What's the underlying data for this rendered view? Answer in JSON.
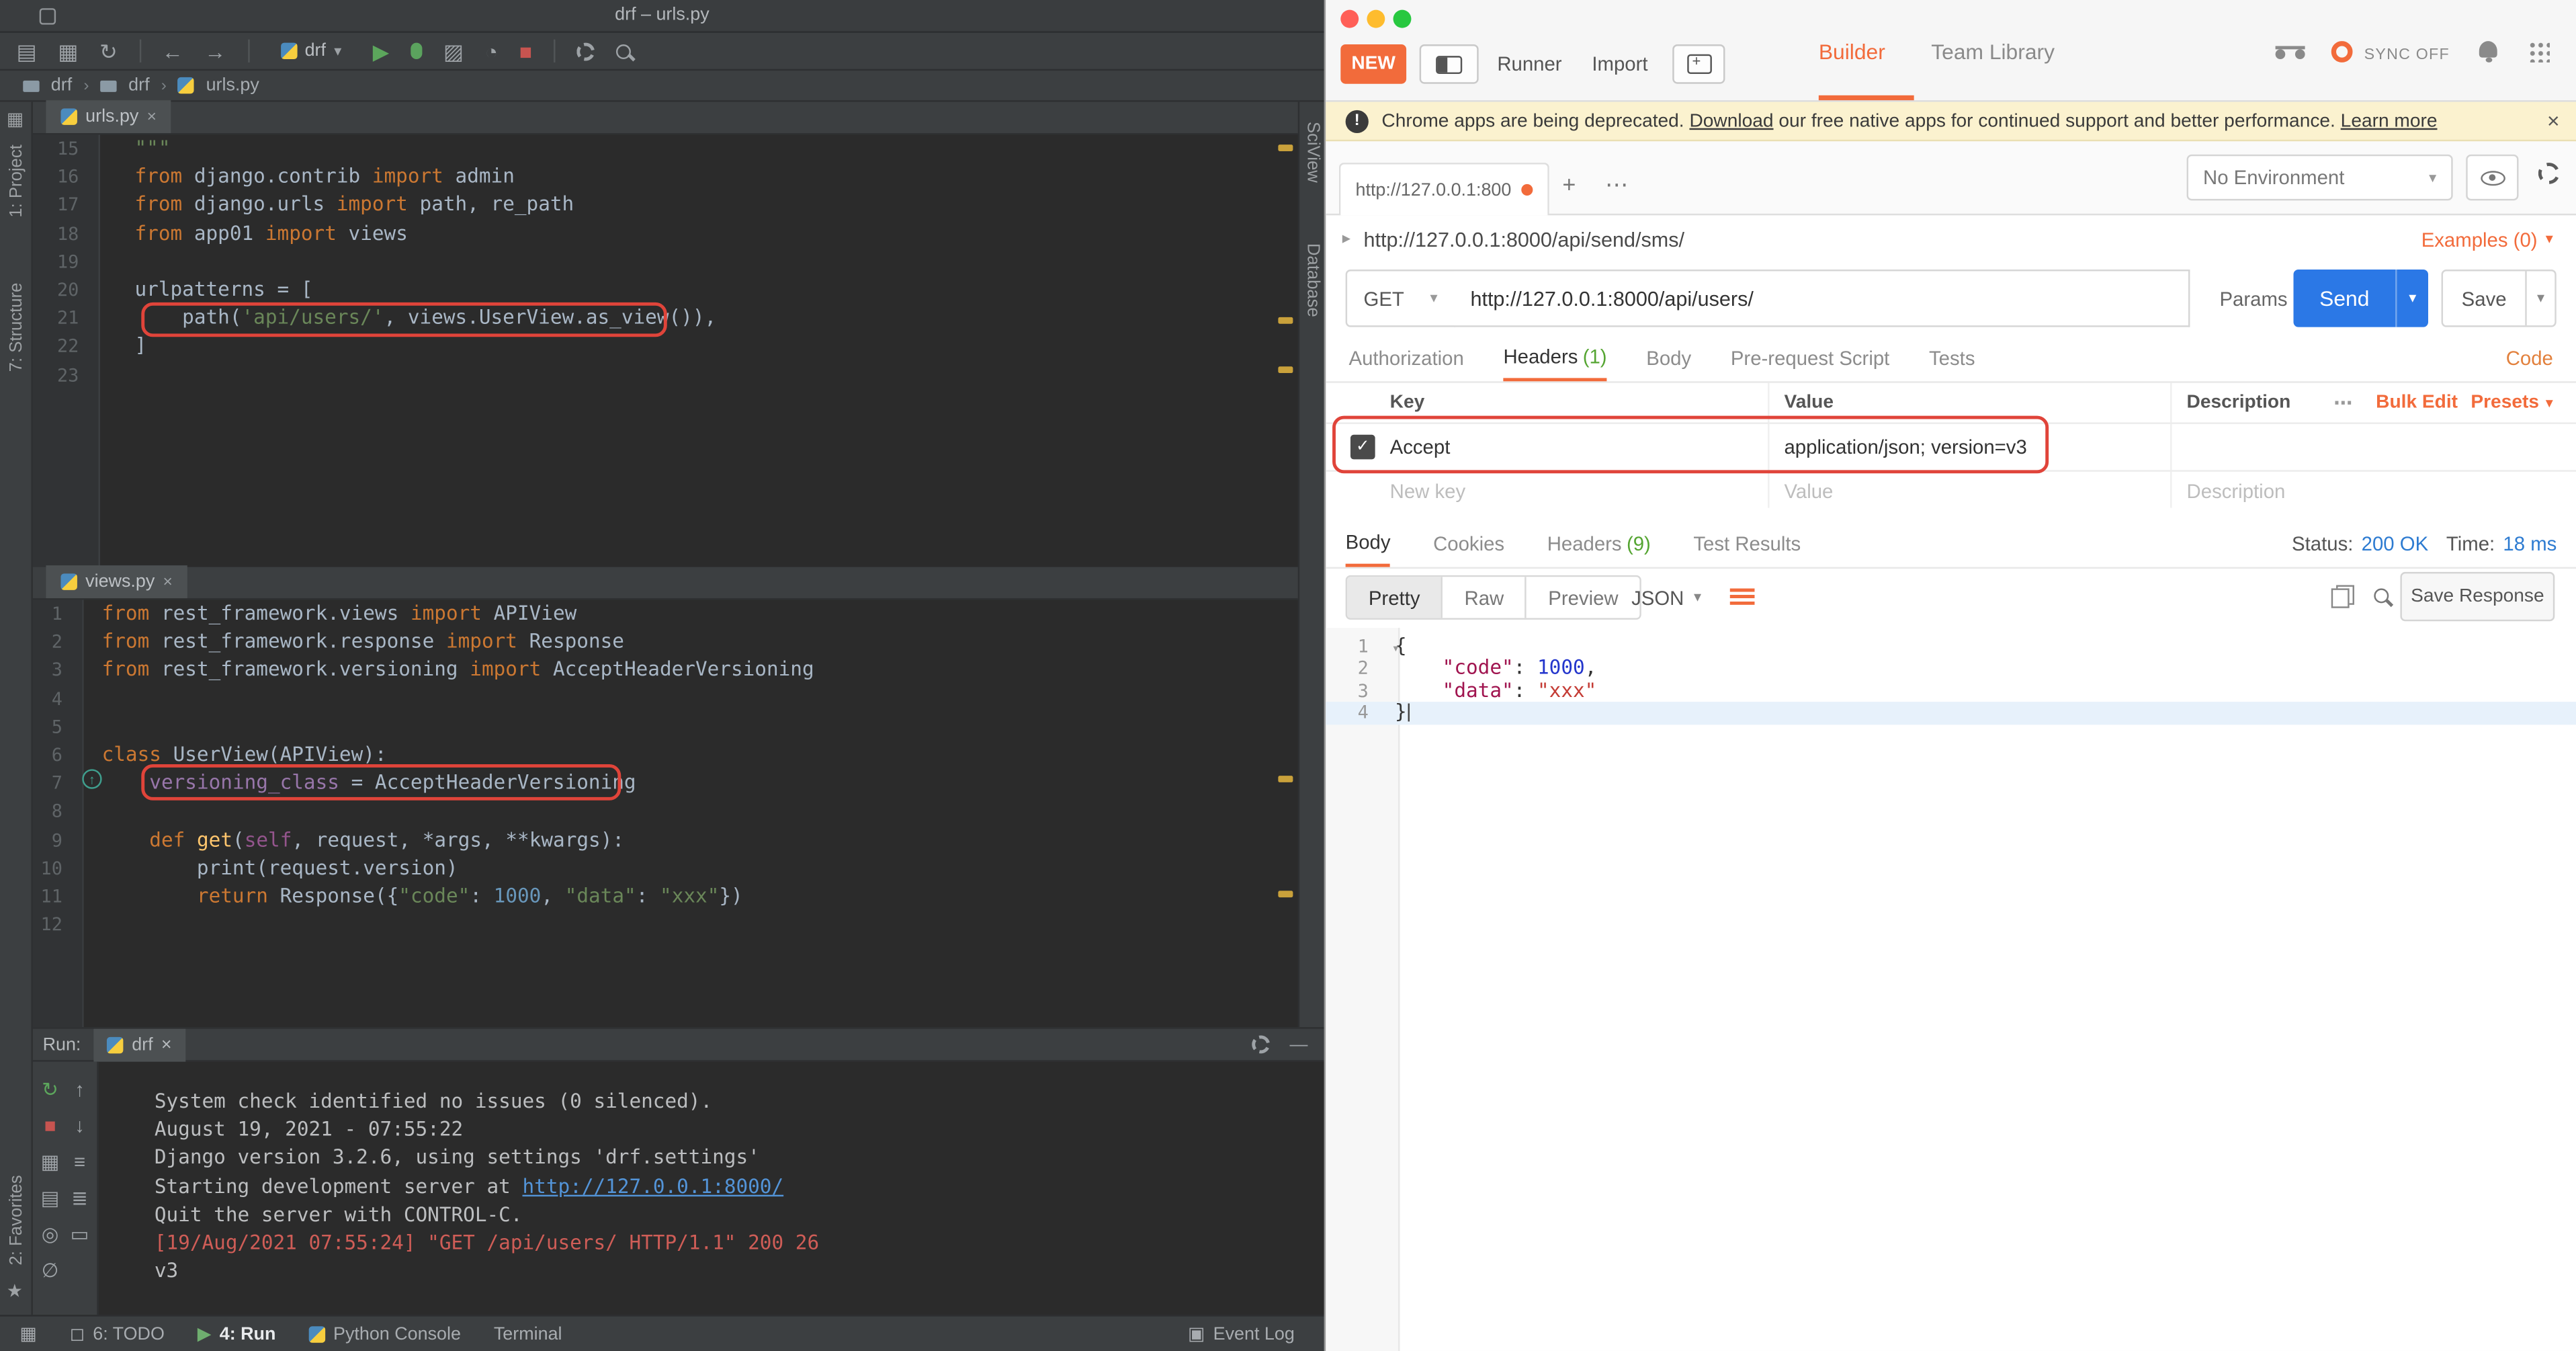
{
  "colors": {
    "accent_orange": "#f26b3b",
    "send_blue": "#2b78e6",
    "annotation_red": "#e0443a",
    "status_blue": "#2d7bd1",
    "ide_bg": "#2b2b2b",
    "ide_panel_bg": "#3c3f41"
  },
  "icons": {
    "open": "▤",
    "save": "▦",
    "refresh": "↻",
    "back": "←",
    "forward": "→",
    "caret_down": "▾",
    "run": "▶",
    "coverage": "▨",
    "profiler": "◔",
    "stop": "■",
    "close": "×",
    "plus": "+",
    "more": "⋯",
    "up": "↑",
    "down": "↓",
    "minus": "—",
    "chevron": "›",
    "expand": "▸",
    "fold": "▾",
    "menu": "≡",
    "menu2": "≣",
    "clear": "∅",
    "pin": "◎",
    "print": "▭",
    "check": "✓",
    "star": "★",
    "grid": "▦",
    "todo": "◻",
    "eventlog": "▣",
    "bang": "!"
  },
  "ide": {
    "title": "drf – urls.py",
    "toolbar": {
      "run_config": "drf"
    },
    "breadcrumbs": [
      "drf",
      "drf",
      "urls.py"
    ],
    "left_stripe": {
      "project": "1: Project",
      "structure": "7: Structure",
      "favorites": "2: Favorites"
    },
    "right_stripe": {
      "sciview": "SciView",
      "database": "Database"
    },
    "editor_urls": {
      "tab": "urls.py",
      "lines": [
        {
          "n": 15,
          "seg": [
            [
              "str",
              "\"\"\""
            ]
          ]
        },
        {
          "n": 16,
          "seg": [
            [
              "kw",
              "from"
            ],
            [
              "pl",
              " django.contrib "
            ],
            [
              "kw",
              "import"
            ],
            [
              "pl",
              " admin"
            ]
          ]
        },
        {
          "n": 17,
          "seg": [
            [
              "kw",
              "from"
            ],
            [
              "pl",
              " django.urls "
            ],
            [
              "kw",
              "import"
            ],
            [
              "pl",
              " path, re_path"
            ]
          ]
        },
        {
          "n": 18,
          "seg": [
            [
              "kw",
              "from"
            ],
            [
              "pl",
              " app01 "
            ],
            [
              "kw",
              "import"
            ],
            [
              "pl",
              " views"
            ]
          ]
        },
        {
          "n": 19,
          "seg": []
        },
        {
          "n": 20,
          "seg": [
            [
              "pl",
              "urlpatterns = ["
            ]
          ]
        },
        {
          "n": 21,
          "seg": [
            [
              "pl",
              "    path("
            ],
            [
              "str",
              "'api/users/'"
            ],
            [
              "pl",
              ", views.UserView.as_view()),"
            ]
          ]
        },
        {
          "n": 22,
          "seg": [
            [
              "pl",
              "]"
            ]
          ]
        },
        {
          "n": 23,
          "seg": []
        }
      ]
    },
    "editor_views": {
      "tab": "views.py",
      "lines": [
        {
          "n": 1,
          "seg": [
            [
              "kw",
              "from"
            ],
            [
              "pl",
              " rest_framework.views "
            ],
            [
              "kw",
              "import"
            ],
            [
              "pl",
              " APIView"
            ]
          ]
        },
        {
          "n": 2,
          "seg": [
            [
              "kw",
              "from"
            ],
            [
              "pl",
              " rest_framework.response "
            ],
            [
              "kw",
              "import"
            ],
            [
              "pl",
              " Response"
            ]
          ]
        },
        {
          "n": 3,
          "seg": [
            [
              "kw",
              "from"
            ],
            [
              "pl",
              " rest_framework.versioning "
            ],
            [
              "kw",
              "import"
            ],
            [
              "pl",
              " AcceptHeaderVersioning"
            ]
          ]
        },
        {
          "n": 4,
          "seg": []
        },
        {
          "n": 5,
          "seg": []
        },
        {
          "n": 6,
          "seg": [
            [
              "kw",
              "class"
            ],
            [
              "pl",
              " UserView(APIView):"
            ]
          ]
        },
        {
          "n": 7,
          "seg": [
            [
              "pl",
              "    "
            ],
            [
              "field",
              "versioning_class"
            ],
            [
              "pl",
              " = AcceptHeaderVersioning"
            ]
          ]
        },
        {
          "n": 8,
          "seg": []
        },
        {
          "n": 9,
          "seg": [
            [
              "pl",
              "    "
            ],
            [
              "kw",
              "def"
            ],
            [
              "pl",
              " "
            ],
            [
              "fn",
              "get"
            ],
            [
              "pl",
              "("
            ],
            [
              "self",
              "self"
            ],
            [
              "pl",
              ", request, *args, **kwargs):"
            ]
          ]
        },
        {
          "n": 10,
          "seg": [
            [
              "pl",
              "        print(request.version)"
            ]
          ]
        },
        {
          "n": 11,
          "seg": [
            [
              "pl",
              "        "
            ],
            [
              "kw",
              "return"
            ],
            [
              "pl",
              " Response({"
            ],
            [
              "str",
              "\"code\""
            ],
            [
              "pl",
              ": "
            ],
            [
              "num",
              "1000"
            ],
            [
              "pl",
              ", "
            ],
            [
              "str",
              "\"data\""
            ],
            [
              "pl",
              ": "
            ],
            [
              "str",
              "\"xxx\""
            ],
            [
              "pl",
              "})"
            ]
          ]
        },
        {
          "n": 12,
          "seg": []
        }
      ]
    },
    "run_panel": {
      "label": "Run:",
      "tab": "drf",
      "console": [
        {
          "seg": [
            [
              "pl",
              "System check identified no issues (0 silenced)."
            ]
          ]
        },
        {
          "seg": [
            [
              "pl",
              "August 19, 2021 - 07:55:22"
            ]
          ]
        },
        {
          "seg": [
            [
              "pl",
              "Django version 3.2.6, using settings 'drf.settings'"
            ]
          ]
        },
        {
          "seg": [
            [
              "pl",
              "Starting development server at "
            ],
            [
              "link",
              "http://127.0.0.1:8000/"
            ]
          ]
        },
        {
          "seg": [
            [
              "pl",
              "Quit the server with CONTROL-C."
            ]
          ]
        },
        {
          "seg": [
            [
              "err",
              "[19/Aug/2021 07:55:24] \"GET /api/users/ HTTP/1.1\" 200 26"
            ]
          ]
        },
        {
          "seg": [
            [
              "pl",
              "v3"
            ]
          ]
        }
      ]
    },
    "status_bar": {
      "todo": "6: TODO",
      "run": "4: Run",
      "python_console": "Python Console",
      "terminal": "Terminal",
      "event_log": "Event Log"
    }
  },
  "postman": {
    "header": {
      "new": "NEW",
      "runner": "Runner",
      "import": "Import",
      "builder": "Builder",
      "team_library": "Team Library",
      "sync": "SYNC OFF"
    },
    "banner": {
      "pre": "Chrome apps are being deprecated. ",
      "link1": "Download",
      "mid": " our free native apps for continued support and better performance. ",
      "link2": "Learn more"
    },
    "tab": {
      "title": "http://127.0.0.1:800"
    },
    "environment": {
      "selected": "No Environment"
    },
    "request_meta": {
      "title": "http://127.0.0.1:8000/api/send/sms/",
      "examples": "Examples (0)"
    },
    "request": {
      "method": "GET",
      "url": "http://127.0.0.1:8000/api/users/",
      "params": "Params",
      "send": "Send",
      "save": "Save"
    },
    "request_tabs": {
      "authorization": "Authorization",
      "headers": "Headers",
      "headers_count": "(1)",
      "body": "Body",
      "prerequest": "Pre-request Script",
      "tests": "Tests",
      "code": "Code"
    },
    "headers_editor": {
      "col_key": "Key",
      "col_value": "Value",
      "col_description": "Description",
      "bulk_edit": "Bulk Edit",
      "presets": "Presets",
      "rows": [
        {
          "key": "Accept",
          "value": "application/json; version=v3"
        }
      ],
      "placeholder_key": "New key",
      "placeholder_value": "Value",
      "placeholder_description": "Description"
    },
    "response_tabs": {
      "body": "Body",
      "cookies": "Cookies",
      "headers": "Headers",
      "headers_count": "(9)",
      "test_results": "Test Results"
    },
    "response_meta": {
      "status_label": "Status:",
      "status_value": "200 OK",
      "time_label": "Time:",
      "time_value": "18 ms"
    },
    "response_toolbar": {
      "pretty": "Pretty",
      "raw": "Raw",
      "preview": "Preview",
      "type": "JSON",
      "save_response": "Save Response"
    },
    "response": {
      "lines": [
        {
          "n": 1,
          "fold": true,
          "seg": [
            [
              "pl",
              "{"
            ]
          ]
        },
        {
          "n": 2,
          "seg": [
            [
              "pl",
              "    "
            ],
            [
              "key",
              "\"code\""
            ],
            [
              "pl",
              ": "
            ],
            [
              "num",
              "1000"
            ],
            [
              "pl",
              ","
            ]
          ]
        },
        {
          "n": 3,
          "seg": [
            [
              "pl",
              "    "
            ],
            [
              "key",
              "\"data\""
            ],
            [
              "pl",
              ": "
            ],
            [
              "str",
              "\"xxx\""
            ]
          ]
        },
        {
          "n": 4,
          "hl": true,
          "cursor": true,
          "seg": [
            [
              "pl",
              "}"
            ]
          ]
        }
      ]
    }
  }
}
